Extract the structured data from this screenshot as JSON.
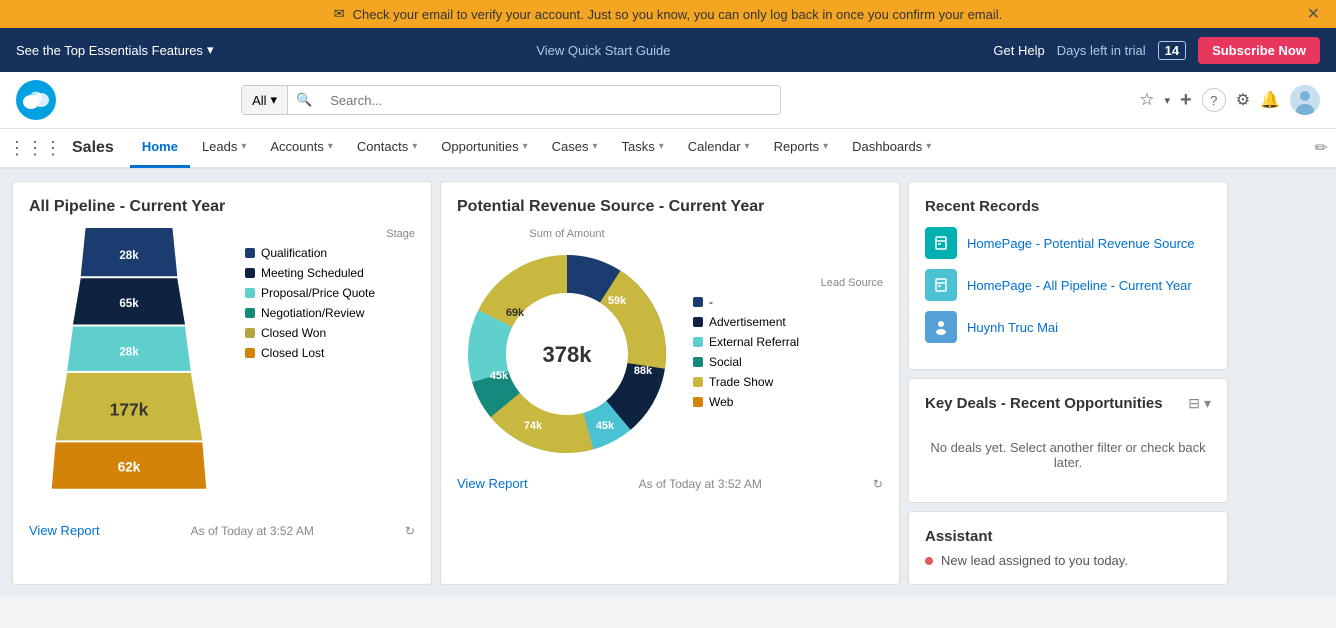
{
  "notif": {
    "message": "Check your email to verify your account. Just so you know, you can only log back in once you confirm your email.",
    "mail_icon": "✉",
    "close_icon": "✕"
  },
  "topnav": {
    "features_label": "See the Top Essentials Features",
    "chevron": "▾",
    "center_link": "View Quick Start Guide",
    "get_help": "Get Help",
    "days_trial_label": "Days left in trial",
    "days_num": "14",
    "subscribe_label": "Subscribe Now"
  },
  "searchbar": {
    "all_label": "All",
    "chevron": "▾",
    "placeholder": "Search...",
    "search_icon": "🔍"
  },
  "icons": {
    "star": "☆",
    "star_down": "▾",
    "plus": "+",
    "help": "?",
    "gear": "⚙",
    "bell": "🔔",
    "avatar_text": "🐱"
  },
  "mainnav": {
    "app_name": "Sales",
    "items": [
      {
        "label": "Home",
        "active": true,
        "has_chevron": false
      },
      {
        "label": "Leads",
        "active": false,
        "has_chevron": true
      },
      {
        "label": "Accounts",
        "active": false,
        "has_chevron": true
      },
      {
        "label": "Contacts",
        "active": false,
        "has_chevron": true
      },
      {
        "label": "Opportunities",
        "active": false,
        "has_chevron": true
      },
      {
        "label": "Cases",
        "active": false,
        "has_chevron": true
      },
      {
        "label": "Tasks",
        "active": false,
        "has_chevron": true
      },
      {
        "label": "Calendar",
        "active": false,
        "has_chevron": true
      },
      {
        "label": "Reports",
        "active": false,
        "has_chevron": true
      },
      {
        "label": "Dashboards",
        "active": false,
        "has_chevron": true
      }
    ]
  },
  "pipeline_card": {
    "title": "All Pipeline - Current Year",
    "view_report": "View Report",
    "timestamp": "As of Today at 3:52 AM",
    "legend_title": "Stage",
    "legend_items": [
      {
        "label": "Qualification",
        "color": "#1a3c6e"
      },
      {
        "label": "Meeting Scheduled",
        "color": "#0d2340"
      },
      {
        "label": "Proposal/Price Quote",
        "color": "#5ecfcd"
      },
      {
        "label": "Negotiation/Review",
        "color": "#14897c"
      },
      {
        "label": "Closed Won",
        "color": "#b5a642"
      },
      {
        "label": "Closed Lost",
        "color": "#d4830a"
      }
    ],
    "funnel_segments": [
      {
        "value": "28k",
        "color": "#1a3c6e",
        "width_pct": 45
      },
      {
        "value": "65k",
        "color": "#0d2340",
        "width_pct": 65
      },
      {
        "value": "28k",
        "color": "#5ecfcd",
        "width_pct": 72
      },
      {
        "value": "177k",
        "color": "#b5bc6e",
        "width_pct": 88
      },
      {
        "value": "62k",
        "color": "#d4830a",
        "width_pct": 100
      }
    ]
  },
  "revenue_card": {
    "title": "Potential Revenue Source - Current Year",
    "view_report": "View Report",
    "timestamp": "As of Today at 3:52 AM",
    "donut_center": "378k",
    "sum_label": "Sum of Amount",
    "lead_source_label": "Lead Source",
    "legend_items": [
      {
        "label": "-",
        "color": "#1a3c6e"
      },
      {
        "label": "Advertisement",
        "color": "#0d2340"
      },
      {
        "label": "External Referral",
        "color": "#5ecfcd"
      },
      {
        "label": "Social",
        "color": "#14897c"
      },
      {
        "label": "Trade Show",
        "color": "#b5a642"
      },
      {
        "label": "Web",
        "color": "#d4830a"
      }
    ],
    "segments": [
      {
        "value": "59k",
        "color": "#1a3c6e",
        "pct": 15.6
      },
      {
        "value": "88k",
        "color": "#0d2340",
        "pct": 23.3
      },
      {
        "value": "45k",
        "color": "#5ecfcd",
        "pct": 11.9
      },
      {
        "value": "74k",
        "color": "#14897c",
        "pct": 19.6
      },
      {
        "value": "45k",
        "color": "#4bc2d4",
        "pct": 11.9
      },
      {
        "value": "69k",
        "color": "#c8b840",
        "pct": 18.3
      }
    ]
  },
  "recent_records": {
    "title": "Recent Records",
    "items": [
      {
        "icon": "🗑",
        "icon_class": "teal",
        "label": "HomePage - Potential Revenue Source"
      },
      {
        "icon": "🗑",
        "icon_class": "blue",
        "label": "HomePage - All Pipeline - Current Year"
      },
      {
        "icon": "👤",
        "icon_class": "person",
        "label": "Huynh Truc Mai"
      }
    ]
  },
  "key_deals": {
    "title": "Key Deals - Recent Opportunities",
    "empty_msg": "No deals yet. Select another filter or check back later."
  },
  "assistant": {
    "title": "Assistant",
    "item_text": "New lead assigned to you today."
  }
}
